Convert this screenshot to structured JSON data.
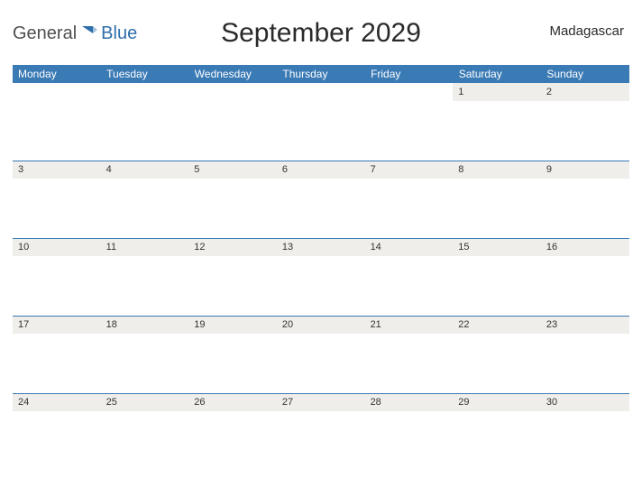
{
  "brand": {
    "general": "General",
    "blue": "Blue"
  },
  "title": "September 2029",
  "country": "Madagascar",
  "dow": [
    "Monday",
    "Tuesday",
    "Wednesday",
    "Thursday",
    "Friday",
    "Saturday",
    "Sunday"
  ],
  "weeks": [
    [
      "",
      "",
      "",
      "",
      "",
      "1",
      "2"
    ],
    [
      "3",
      "4",
      "5",
      "6",
      "7",
      "8",
      "9"
    ],
    [
      "10",
      "11",
      "12",
      "13",
      "14",
      "15",
      "16"
    ],
    [
      "17",
      "18",
      "19",
      "20",
      "21",
      "22",
      "23"
    ],
    [
      "24",
      "25",
      "26",
      "27",
      "28",
      "29",
      "30"
    ]
  ]
}
